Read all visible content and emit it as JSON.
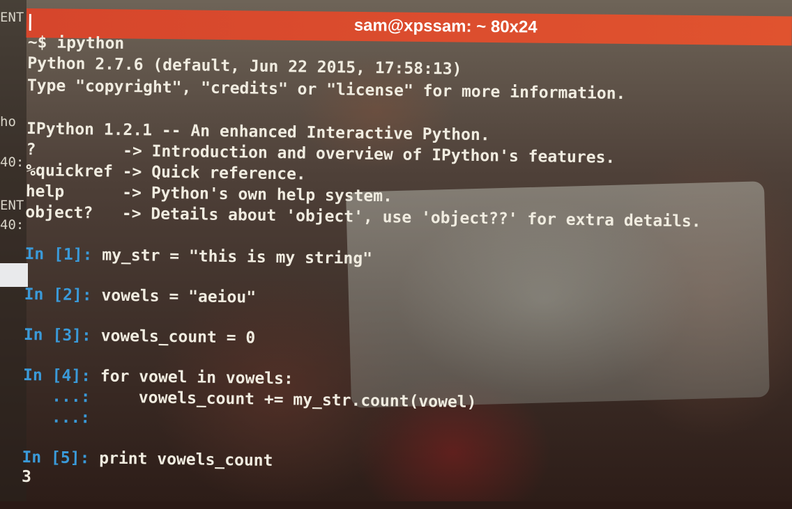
{
  "window": {
    "title": "sam@xpssam: ~ 80x24"
  },
  "side_pane": {
    "fragments": [
      "ENT",
      "ho",
      "40:",
      "ENT",
      "40:"
    ]
  },
  "terminal": {
    "command_line": "~$ ipython",
    "banner": [
      "Python 2.7.6 (default, Jun 22 2015, 17:58:13)",
      "Type \"copyright\", \"credits\" or \"license\" for more information.",
      "",
      "IPython 1.2.1 -- An enhanced Interactive Python.",
      "?         -> Introduction and overview of IPython's features.",
      "%quickref -> Quick reference.",
      "help      -> Python's own help system.",
      "object?   -> Details about 'object', use 'object??' for extra details."
    ],
    "cells": [
      {
        "prompt": "In [1]:",
        "code": " my_str = \"this is my string\""
      },
      {
        "prompt": "In [2]:",
        "code": " vowels = \"aeiou\""
      },
      {
        "prompt": "In [3]:",
        "code": " vowels_count = 0"
      },
      {
        "prompt": "In [4]:",
        "code": " for vowel in vowels:"
      },
      {
        "prompt": "   ...:",
        "code": "     vowels_count += my_str.count(vowel)"
      },
      {
        "prompt": "   ...:",
        "code": ""
      },
      {
        "prompt": "In [5]:",
        "code": " print vowels_count"
      }
    ],
    "output": "3"
  }
}
